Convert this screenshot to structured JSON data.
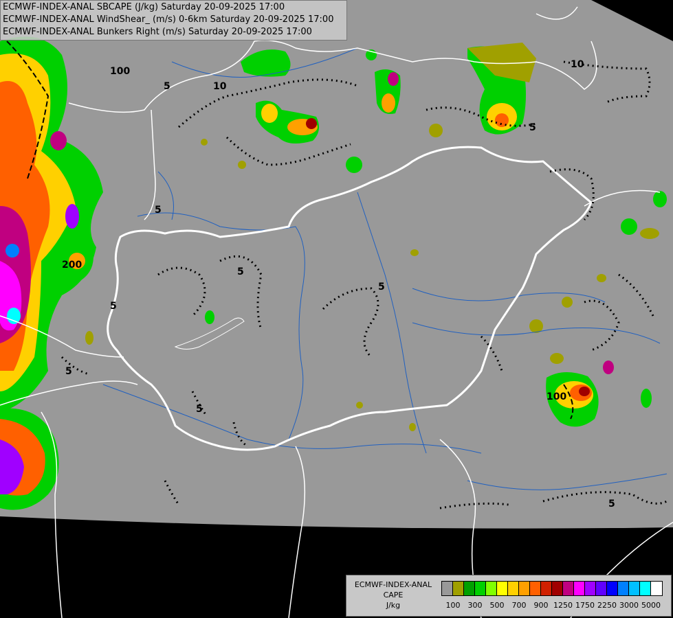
{
  "header": {
    "lines": [
      "ECMWF-INDEX-ANAL SBCAPE (J/kg) Saturday 20-09-2025 17:00",
      "ECMWF-INDEX-ANAL WindShear_ (m/s) 0-6km Saturday 20-09-2025 17:00",
      "ECMWF-INDEX-ANAL Bunkers Right (m/s) Saturday 20-09-2025 17:00"
    ]
  },
  "legend": {
    "title_line1": "ECMWF-INDEX-ANAL",
    "title_line2": "CAPE",
    "title_line3": "J/kg",
    "colors": [
      "#999999",
      "#a0a000",
      "#00a000",
      "#00d000",
      "#80ff00",
      "#ffff00",
      "#ffd000",
      "#ffa000",
      "#ff6000",
      "#d02000",
      "#a00000",
      "#c00080",
      "#ff00ff",
      "#a000ff",
      "#6000ff",
      "#0000ff",
      "#0080ff",
      "#00c0ff",
      "#00ffff",
      "#ffffff"
    ],
    "ticks": [
      "100",
      "300",
      "500",
      "700",
      "900",
      "1250",
      "1750",
      "2250",
      "3000",
      "5000"
    ]
  },
  "map": {
    "contour_labels": [
      "100",
      "200",
      "10",
      "5",
      "5",
      "5",
      "5",
      "5",
      "5",
      "5",
      "10",
      "100",
      "5",
      "5"
    ],
    "colors": {
      "land": "#999999",
      "outside": "#000000",
      "border_hu": "#ffffff",
      "borders": "#ffffff",
      "rivers": "#2060c0",
      "dotted": "#000000"
    }
  }
}
